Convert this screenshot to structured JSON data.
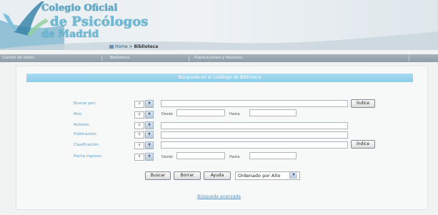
{
  "header": {
    "logo_line1": "Colegio Oficial",
    "logo_line2": "de Psicólogos",
    "logo_line3": "de Madrid",
    "breadcrumb_home": "Home",
    "breadcrumb_sep": " > ",
    "breadcrumb_current": "Biblioteca"
  },
  "nav": {
    "items": [
      "Centro de datos",
      "Biblioteca",
      "Publicaciones y Revistas"
    ]
  },
  "search": {
    "title": "Búsqueda en el Catálogo de Biblioteca",
    "rows": [
      {
        "label": "Buscar por:",
        "operator": "Y"
      },
      {
        "label": "Año:",
        "operator": "Y",
        "from_label": "Desde",
        "to_label": "Hasta"
      },
      {
        "label": "Autores:",
        "operator": "Y"
      },
      {
        "label": "Publicación:",
        "operator": "Y"
      },
      {
        "label": "Clasificación:",
        "operator": "Y"
      },
      {
        "label": "Fecha ingreso:",
        "operator": "Y",
        "from_label": "Desde",
        "to_label": "Hasta"
      }
    ],
    "indice_label": "Índice",
    "buttons": {
      "buscar": "Buscar",
      "borrar": "Borrar",
      "ayuda": "Ayuda"
    },
    "order_selected": "Ordenado por Año",
    "bottom_link": "Búsqueda avanzada"
  },
  "colors": {
    "accent": "#8cccea",
    "label": "#5a9cc6",
    "nav": "#9aa9b3"
  }
}
